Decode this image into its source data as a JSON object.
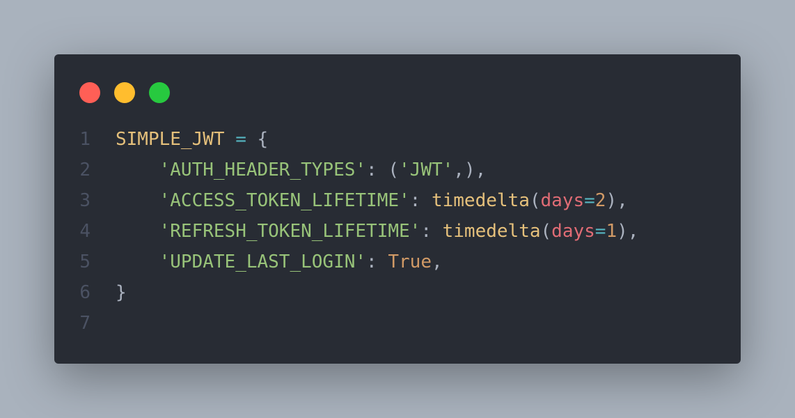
{
  "window": {
    "controls": [
      "close",
      "minimize",
      "maximize"
    ]
  },
  "code": {
    "line_numbers": [
      "1",
      "2",
      "3",
      "4",
      "5",
      "6",
      "7"
    ],
    "l1": {
      "name": "SIMPLE_JWT",
      "op": "=",
      "brace": "{"
    },
    "l2": {
      "indent": "    ",
      "key": "'AUTH_HEADER_TYPES'",
      "colon": ": ",
      "open": "(",
      "val": "'JWT'",
      "close": ",),"
    },
    "l3": {
      "indent": "    ",
      "key": "'ACCESS_TOKEN_LIFETIME'",
      "colon": ": ",
      "fn": "timedelta",
      "open": "(",
      "kw": "days",
      "eq": "=",
      "num": "2",
      "close": "),"
    },
    "l4": {
      "indent": "    ",
      "key": "'REFRESH_TOKEN_LIFETIME'",
      "colon": ": ",
      "fn": "timedelta",
      "open": "(",
      "kw": "days",
      "eq": "=",
      "num": "1",
      "close": "),"
    },
    "l5": {
      "indent": "    ",
      "key": "'UPDATE_LAST_LOGIN'",
      "colon": ": ",
      "bool": "True",
      "comma": ","
    },
    "l6": {
      "brace": "}"
    }
  },
  "colors": {
    "background": "#a9b2bd",
    "window": "#282c34",
    "string": "#98c379",
    "function": "#e5c07b",
    "keyword_arg": "#e06c75",
    "number": "#d19a66",
    "operator": "#56b6c2"
  }
}
